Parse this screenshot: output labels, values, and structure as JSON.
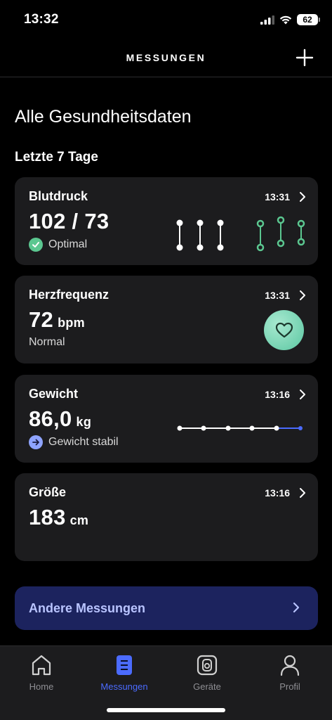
{
  "status_bar": {
    "time": "13:32",
    "battery": "62"
  },
  "header": {
    "title": "MESSUNGEN"
  },
  "page": {
    "title": "Alle Gesundheitsdaten",
    "section": "Letzte 7 Tage"
  },
  "cards": [
    {
      "title": "Blutdruck",
      "time": "13:31",
      "value": "102 / 73",
      "unit": "",
      "status": "Optimal"
    },
    {
      "title": "Herzfrequenz",
      "time": "13:31",
      "value": "72",
      "unit": "bpm",
      "status": "Normal"
    },
    {
      "title": "Gewicht",
      "time": "13:16",
      "value": "86,0",
      "unit": "kg",
      "status": "Gewicht stabil"
    },
    {
      "title": "Größe",
      "time": "13:16",
      "value": "183",
      "unit": "cm",
      "status": ""
    }
  ],
  "other_button": {
    "label": "Andere Messungen"
  },
  "tabs": [
    {
      "label": "Home",
      "icon": "house-icon"
    },
    {
      "label": "Messungen",
      "icon": "list-icon",
      "active": true
    },
    {
      "label": "Geräte",
      "icon": "device-icon"
    },
    {
      "label": "Profil",
      "icon": "person-icon"
    }
  ],
  "colors": {
    "accent": "#4b6bff",
    "green": "#5bc790",
    "card_bg": "#1c1c1e",
    "button_bg": "#1c235e"
  }
}
